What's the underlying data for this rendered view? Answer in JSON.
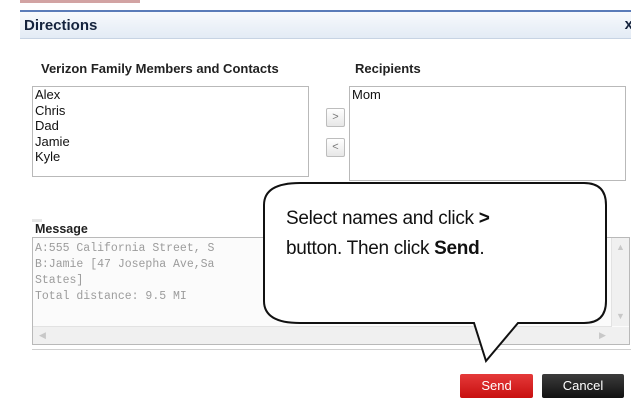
{
  "dialog": {
    "title": "Directions",
    "close_glyph": "x"
  },
  "contacts": {
    "label": "Verizon Family Members and Contacts",
    "items": [
      "Alex",
      "Chris",
      "Dad",
      "Jamie",
      "Kyle"
    ]
  },
  "recipients": {
    "label": "Recipients",
    "items": [
      "Mom"
    ]
  },
  "move_buttons": {
    "add_label": ">",
    "remove_label": "<"
  },
  "message": {
    "label": "Message",
    "text": "A:555 California Street, S\nB:Jamie [47 Josepha Ave,Sa\nStates]\nTotal distance: 9.5 MI"
  },
  "buttons": {
    "send": "Send",
    "cancel": "Cancel"
  },
  "callout": {
    "line1_text": "Select names and click ",
    "line1_bold": ">",
    "line2_text": "button. Then click ",
    "line2_bold": "Send",
    "line2_end": "."
  },
  "colors": {
    "send": "#d81f1f",
    "cancel": "#222222",
    "title_bar": "#e8eef7"
  }
}
